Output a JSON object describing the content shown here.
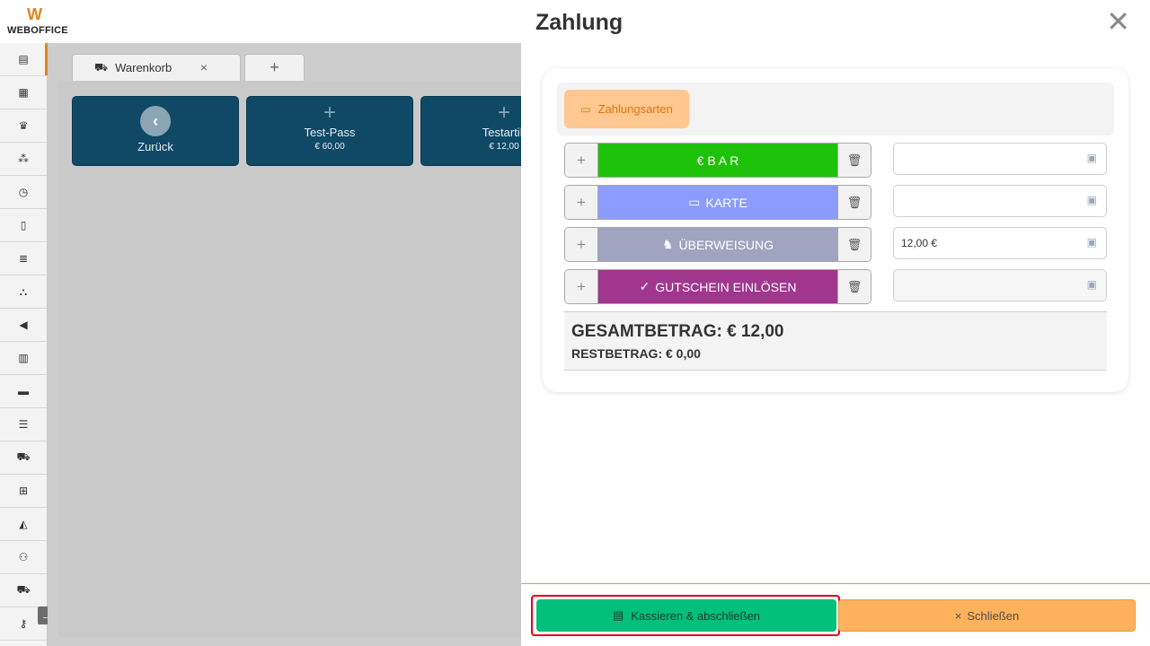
{
  "brand": {
    "mark": "W",
    "name": "WEBOFFICE"
  },
  "sidebar": {
    "items": [
      {
        "icon": "register-icon",
        "glyph": "▤"
      },
      {
        "icon": "calendar-icon",
        "glyph": "▦"
      },
      {
        "icon": "crown-icon",
        "glyph": "♛"
      },
      {
        "icon": "network-icon",
        "glyph": "⁂"
      },
      {
        "icon": "clock-icon",
        "glyph": "◷"
      },
      {
        "icon": "document-icon",
        "glyph": "▯"
      },
      {
        "icon": "list-icon",
        "glyph": "≣"
      },
      {
        "icon": "boxes-icon",
        "glyph": "⛬"
      },
      {
        "icon": "megaphone-icon",
        "glyph": "◀"
      },
      {
        "icon": "chart-icon",
        "glyph": "▥"
      },
      {
        "icon": "folder-icon",
        "glyph": "▬"
      },
      {
        "icon": "database-icon",
        "glyph": "☰"
      },
      {
        "icon": "cart-icon",
        "glyph": "⛟"
      },
      {
        "icon": "hierarchy-icon",
        "glyph": "⊞"
      },
      {
        "icon": "area-chart-icon",
        "glyph": "◭"
      },
      {
        "icon": "users-icon",
        "glyph": "⚇"
      },
      {
        "icon": "truck-icon",
        "glyph": "⛟"
      },
      {
        "icon": "key-icon",
        "glyph": "⚷"
      }
    ],
    "toggle_glyph": "→"
  },
  "tabs": {
    "cart_label": "Warenkorb",
    "cart_close": "×",
    "add_label": "+"
  },
  "tiles": {
    "back": {
      "label": "Zurück",
      "glyph": "‹"
    },
    "pass": {
      "plus": "+",
      "name": "Test-Pass",
      "price": "€ 60,00"
    },
    "article": {
      "plus": "+",
      "name": "Testartik",
      "price": "€ 12,00"
    }
  },
  "modal": {
    "title": "Zahlung",
    "close_glyph": "✕",
    "methods_tab": "Zahlungsarten",
    "payments": [
      {
        "label": "€ B A R",
        "color": "#1fc20b",
        "value": "",
        "plus": "+",
        "icon": "euro-icon"
      },
      {
        "label": "KARTE",
        "color": "#8c9cff",
        "value": "",
        "plus": "+",
        "icon": "credit-card-icon"
      },
      {
        "label": "ÜBERWEISUNG",
        "color": "#a0a4c0",
        "value": "12,00 €",
        "plus": "+",
        "icon": "piggy-bank-icon"
      },
      {
        "label": "GUTSCHEIN EINLÖSEN",
        "color": "#a0368e",
        "value": "",
        "plus": "+",
        "icon": "check-icon"
      }
    ],
    "total_label": "GESAMTBETRAG: € 12,00",
    "rest_label": "RESTBETRAG: € 0,00",
    "checkout_label": "Kassieren & abschließen",
    "close_label": "Schließen",
    "close_btn_glyph": "×"
  }
}
